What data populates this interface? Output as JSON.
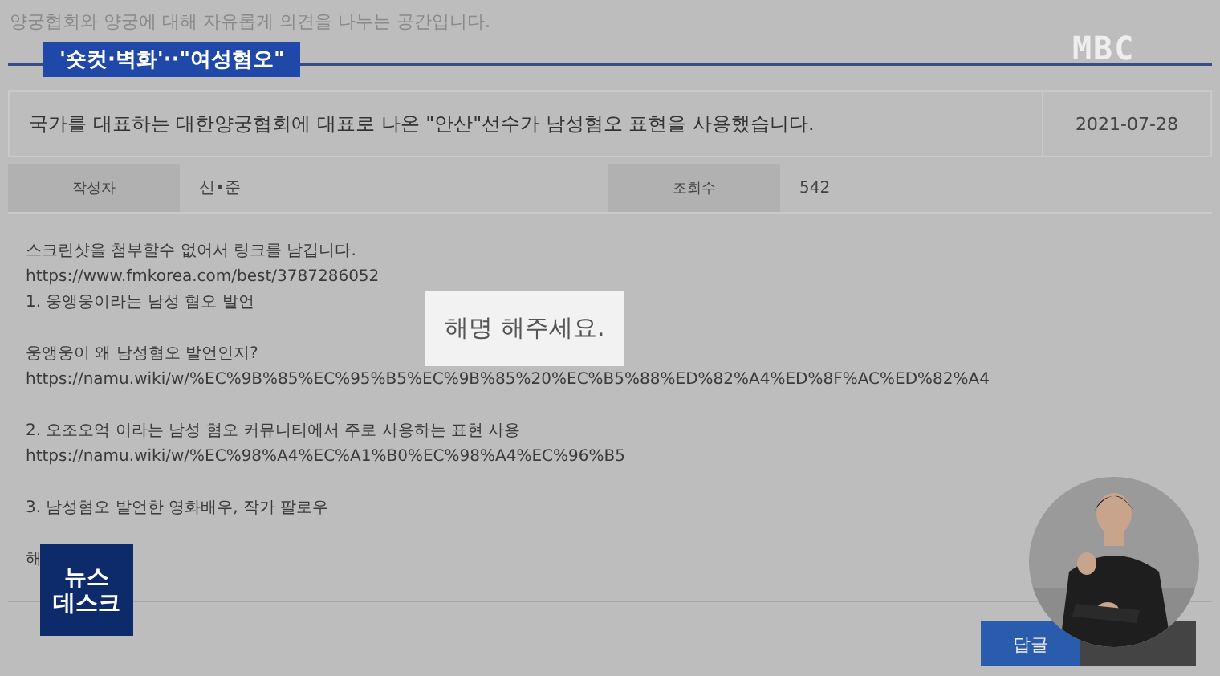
{
  "board_description": "양궁협회와 양궁에 대해 자유롭게 의견을 나누는 공간입니다.",
  "caption": "'숏컷·벽화'··\"여성혐오\"",
  "channel_logo": "MBC",
  "post": {
    "title": "국가를 대표하는 대한양궁협회에 대표로 나온 \"안산\"선수가 남성혐오 표현을 사용했습니다.",
    "date": "2021-07-28",
    "meta": [
      {
        "label": "작성자",
        "value": "신•준"
      },
      {
        "label": "조회수",
        "value": "542"
      }
    ],
    "paragraphs": [
      [
        "스크린샷을 첨부할수 없어서 링크를 남깁니다.",
        "https://www.fmkorea.com/best/3787286052",
        "1. 웅앵웅이라는 남성 혐오 발언"
      ],
      [
        "웅앵웅이 왜 남성혐오 발언인지?",
        "https://namu.wiki/w/%EC%9B%85%EC%95%B5%EC%9B%85%20%EC%B5%88%ED%82%A4%ED%8F%AC%ED%82%A4"
      ],
      [
        "2. 오조오억 이라는 남성 혐오 커뮤니티에서 주로 사용하는 표현 사용",
        "https://namu.wiki/w/%EC%98%A4%EC%A1%B0%EC%98%A4%EC%96%B5"
      ],
      [
        "3. 남성혐오 발언한 영화배우, 작가 팔로우"
      ],
      [
        "해"
      ]
    ],
    "highlight": "해명 해주세요."
  },
  "program_logo": "뉴스\n데스크",
  "buttons": [
    {
      "label": "답글"
    }
  ]
}
